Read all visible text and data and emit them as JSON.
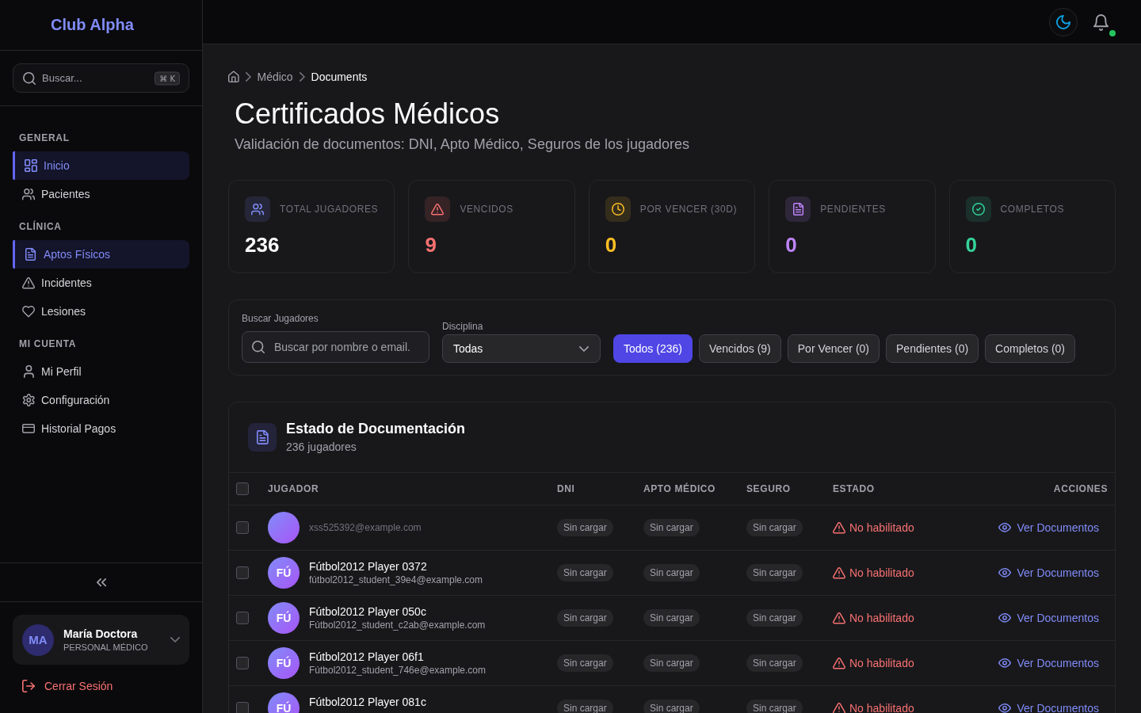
{
  "sidebar": {
    "logo": "Club Alpha",
    "search": {
      "placeholder": "Buscar...",
      "shortcut": "⌘ K"
    },
    "sections": [
      {
        "title": "GENERAL",
        "items": [
          {
            "kind": "dashboard",
            "label": "Inicio",
            "selected": true
          },
          {
            "kind": "users",
            "label": "Pacientes",
            "selected": false
          }
        ]
      },
      {
        "title": "CLÍNICA",
        "items": [
          {
            "kind": "file",
            "label": "Aptos Físicos",
            "selected": true
          },
          {
            "kind": "alert",
            "label": "Incidentes",
            "selected": false
          },
          {
            "kind": "heart",
            "label": "Lesiones",
            "selected": false
          }
        ]
      },
      {
        "title": "MI CUENTA",
        "items": [
          {
            "kind": "user",
            "label": "Mi Perfil",
            "selected": false
          },
          {
            "kind": "settings",
            "label": "Configuración",
            "selected": false
          },
          {
            "kind": "card",
            "label": "Historial Pagos",
            "selected": false
          }
        ]
      }
    ],
    "user": {
      "initials": "MA",
      "name": "María Doctora",
      "role": "PERSONAL MÉDICO"
    },
    "logout": "Cerrar Sesión"
  },
  "topbar": {
    "notifications": {
      "unread": true
    }
  },
  "breadcrumb": [
    "Médico",
    "Documents"
  ],
  "header": {
    "title": "Certificados Médicos",
    "subtitle": "Validación de documentos: DNI, Apto Médico, Seguros de los jugadores"
  },
  "stats": [
    {
      "kind": "total",
      "label": "TOTAL JUGADORES",
      "value": "236",
      "color": "#818cf8"
    },
    {
      "kind": "expired",
      "label": "VENCIDOS",
      "value": "9",
      "color": "#f87171"
    },
    {
      "kind": "expiring",
      "label": "POR VENCER (30D)",
      "value": "0",
      "color": "#fbbf24"
    },
    {
      "kind": "pending",
      "label": "PENDIENTES",
      "value": "0",
      "color": "#c084fc"
    },
    {
      "kind": "complete",
      "label": "COMPLETOS",
      "value": "0",
      "color": "#34d399"
    }
  ],
  "filters": {
    "search": {
      "label": "Buscar Jugadores",
      "placeholder": "Buscar por nombre o email."
    },
    "discipline": {
      "label": "Disciplina",
      "value": "Todas"
    },
    "status_buttons": [
      {
        "label": "Todos (236)",
        "selected": true
      },
      {
        "label": "Vencidos (9)",
        "selected": false
      },
      {
        "label": "Por Vencer (0)",
        "selected": false
      },
      {
        "label": "Pendientes (0)",
        "selected": false
      },
      {
        "label": "Completos (0)",
        "selected": false
      }
    ]
  },
  "documents": {
    "title": "Estado de Documentación",
    "subtitle": "236 jugadores",
    "table": {
      "select_all": {
        "checked": false
      },
      "columns": [
        "JUGADOR",
        "DNI",
        "APTO MÉDICO",
        "SEGURO",
        "ESTADO",
        "ACCIONES"
      ],
      "rows": [
        {
          "checked": false,
          "email": "xss525392@example.com",
          "dni": "Sin cargar",
          "apto_medico": "Sin cargar",
          "seguro": "Sin cargar",
          "status": {
            "kind": "blocked",
            "label": "No habilitado"
          },
          "action": "Ver Documentos"
        },
        {
          "checked": false,
          "initials": "FÚ",
          "name": "Fútbol2012 Player 0372",
          "email": "fútbol2012_student_39e4@example.com",
          "dni": "Sin cargar",
          "apto_medico": "Sin cargar",
          "seguro": "Sin cargar",
          "status": {
            "kind": "blocked",
            "label": "No habilitado"
          },
          "action": "Ver Documentos"
        },
        {
          "checked": false,
          "initials": "FÚ",
          "name": "Fútbol2012 Player 050c",
          "email": "Fútbol2012_student_c2ab@example.com",
          "dni": "Sin cargar",
          "apto_medico": "Sin cargar",
          "seguro": "Sin cargar",
          "status": {
            "kind": "blocked",
            "label": "No habilitado"
          },
          "action": "Ver Documentos"
        },
        {
          "checked": false,
          "initials": "FÚ",
          "name": "Fútbol2012 Player 06f1",
          "email": "Fútbol2012_student_746e@example.com",
          "dni": "Sin cargar",
          "apto_medico": "Sin cargar",
          "seguro": "Sin cargar",
          "status": {
            "kind": "blocked",
            "label": "No habilitado"
          },
          "action": "Ver Documentos"
        },
        {
          "checked": false,
          "initials": "FÚ",
          "name": "Fútbol2012 Player 081c",
          "dni": "Sin cargar",
          "apto_medico": "Sin cargar",
          "seguro": "Sin cargar",
          "status": {
            "kind": "blocked",
            "label": "No habilitado"
          },
          "action": "Ver Documentos"
        }
      ]
    }
  }
}
